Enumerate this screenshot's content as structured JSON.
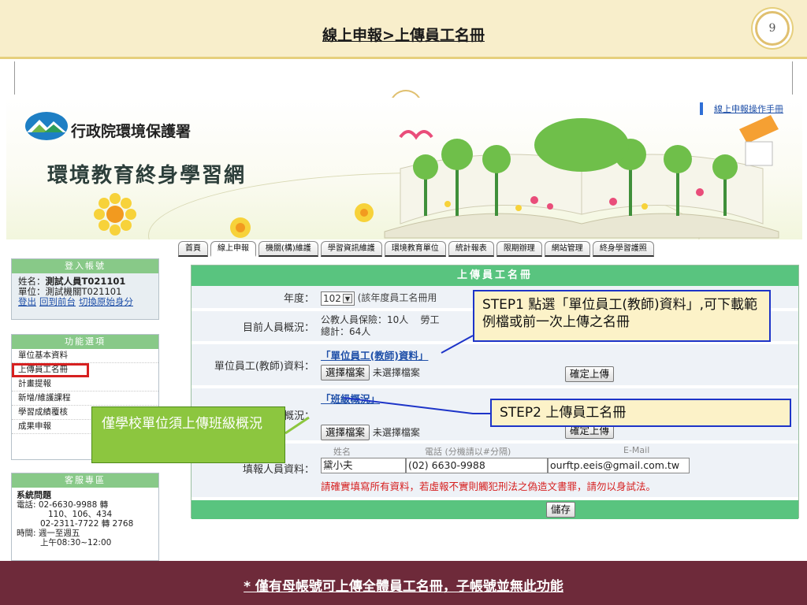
{
  "slide": {
    "title": "線上申報>上傳員工名冊",
    "page_number": "9",
    "footer_note": "* 僅有母帳號可上傳全體員工名冊，子帳號並無此功能"
  },
  "banner": {
    "agency": "行政院環境保護署",
    "site_name": "環境教育終身學習網",
    "manual_link": "線上申報操作手冊"
  },
  "nav": {
    "tabs": [
      "首頁",
      "線上申報",
      "機關(構)維護",
      "學習資訊維護",
      "環境教育單位",
      "統計報表",
      "限期辦理",
      "網站管理",
      "終身學習護照"
    ],
    "active_index": 1
  },
  "sidebar": {
    "login": {
      "title": "登入帳號",
      "name_label": "姓名：",
      "name_value": "測試人員T021101",
      "unit_label": "單位：",
      "unit_value": "測試機關T021101",
      "links": [
        "登出",
        "回到前台",
        "切換原始身分"
      ]
    },
    "functions": {
      "title": "功能選項",
      "items": [
        "單位基本資料",
        "上傳員工名冊",
        "計畫提報",
        "新增/維護課程",
        "學習成績覆核",
        "成果申報"
      ],
      "highlighted_index": 1
    },
    "service": {
      "title": "客服專區",
      "heading": "系統問題",
      "lines": [
        "電話: 02-6630-9988 轉",
        "110、106、434",
        "02-2311-7722 轉 2768",
        "時間: 週一至週五",
        "上午08:30~12:00"
      ]
    }
  },
  "form": {
    "title": "上傳員工名冊",
    "year_label": "年度：",
    "year_value": "102",
    "year_note": "(該年度員工名冊用",
    "status_label": "目前人員概況：",
    "status_line1": "公教人員保險：10人",
    "status_line1_tail": "勞工",
    "status_line2": "總計：64人",
    "staff_label": "單位員工(教師)資料：",
    "staff_link": "「單位員工(教師)資料」",
    "choose_file": "選擇檔案",
    "no_file": "未選擇檔案",
    "confirm_upload": "確定上傳",
    "class_label_partial": "班級概況：",
    "class_link": "「班級概況」",
    "filler_label": "填報人員資料：",
    "col_name": "姓名",
    "col_phone": "電話 (分機請以#分隔)",
    "col_email": "E-Mail",
    "filler_name": "黛小夫",
    "filler_phone": "(02) 6630-9988",
    "filler_email": "ourftp.eeis@gmail.com.tw",
    "warning": "請確實填寫所有資料，若虛報不實則觸犯刑法之偽造文書罪，請勿以身試法。",
    "save": "儲存"
  },
  "callouts": {
    "step1": "STEP1 點選「單位員工(教師)資料」,可下載範例檔或前一次上傳之名冊",
    "step2": "STEP2 上傳員工名冊",
    "tip": "僅學校單位須上傳班級概況"
  },
  "colors": {
    "accent_green": "#59c47f",
    "callout_border": "#1d34c8",
    "highlight_red": "#d62020",
    "footer_band": "#6e2a3a"
  }
}
